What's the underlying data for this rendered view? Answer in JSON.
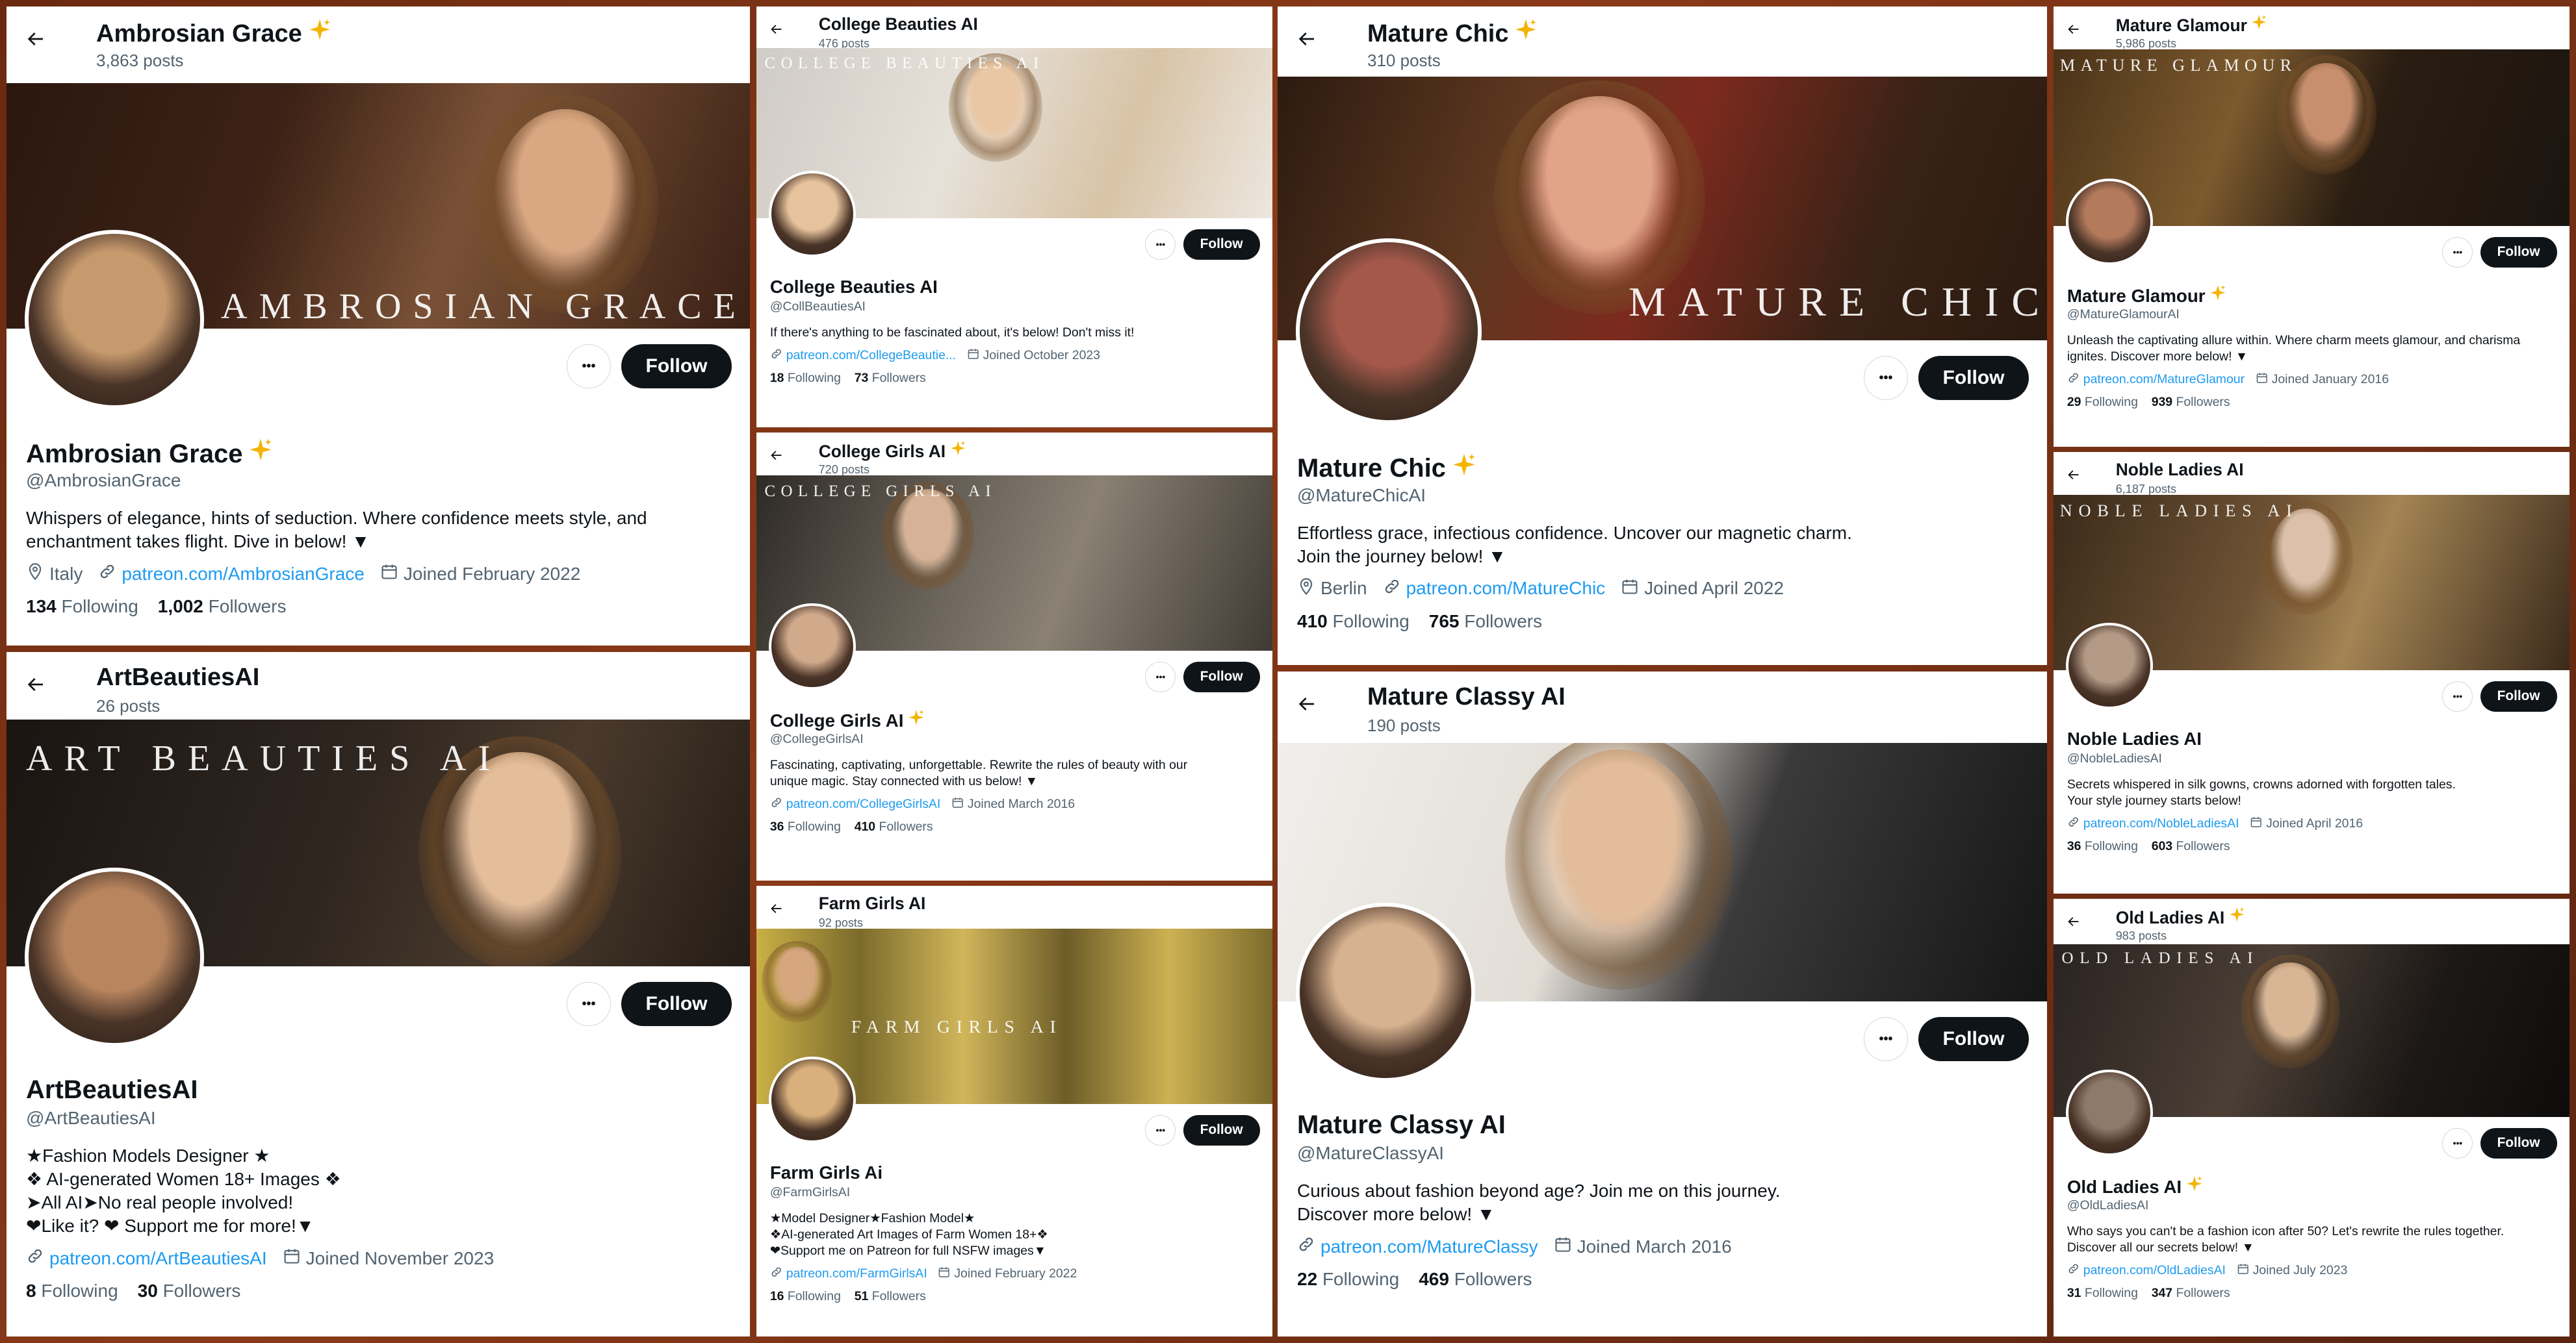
{
  "profiles": [
    {
      "header_name": "Ambrosian Grace",
      "posts": "3,863 posts",
      "banner_title": "AMBROSIAN GRACE AI",
      "name": "Ambrosian Grace",
      "handle": "@AmbrosianGrace",
      "bio": [
        "Whispers of elegance, hints of seduction. Where confidence meets style, and",
        "enchantment takes flight. Dive in below! ▼"
      ],
      "location": "Italy",
      "link": "patreon.com/AmbrosianGrace",
      "joined": "Joined February 2022",
      "following": "134",
      "followers": "1,002",
      "following_label": "Following",
      "followers_label": "Followers",
      "follow": "Follow",
      "more": "•••",
      "verified": true
    },
    {
      "header_name": "ArtBeautiesAI",
      "posts": "26 posts",
      "banner_title": "ART BEAUTIES AI",
      "name": "ArtBeautiesAI",
      "handle": "@ArtBeautiesAI",
      "bio": [
        "★Fashion Models Designer ★",
        "❖ AI-generated Women 18+ Images ❖",
        "➤All AI➤No real people involved!",
        "❤Like it? ❤ Support me for more!▼"
      ],
      "location": "",
      "link": "patreon.com/ArtBeautiesAI",
      "joined": "Joined November 2023",
      "following": "8",
      "followers": "30",
      "following_label": "Following",
      "followers_label": "Followers",
      "follow": "Follow",
      "more": "•••",
      "verified": false
    },
    {
      "header_name": "College Beauties AI",
      "posts": "476 posts",
      "banner_title": "COLLEGE BEAUTIES AI",
      "name": "College Beauties AI",
      "handle": "@CollBeautiesAI",
      "bio": [
        "If there's anything to be fascinated about, it's below! Don't miss it!"
      ],
      "location": "",
      "link": "patreon.com/CollegeBeautie...",
      "joined": "Joined October 2023",
      "following": "18",
      "followers": "73",
      "following_label": "Following",
      "followers_label": "Followers",
      "follow": "Follow",
      "more": "•••",
      "verified": false
    },
    {
      "header_name": "College Girls AI",
      "posts": "720 posts",
      "banner_title": "COLLEGE GIRLS AI",
      "name": "College Girls AI",
      "handle": "@CollegeGirlsAI",
      "bio": [
        "Fascinating, captivating, unforgettable. Rewrite the rules of beauty with our",
        "unique magic. Stay connected with us below! ▼"
      ],
      "location": "",
      "link": "patreon.com/CollegeGirlsAI",
      "joined": "Joined March 2016",
      "following": "36",
      "followers": "410",
      "following_label": "Following",
      "followers_label": "Followers",
      "follow": "Follow",
      "more": "•••",
      "verified": true
    },
    {
      "header_name": "Farm Girls AI",
      "posts": "92 posts",
      "banner_title": "FARM GIRLS AI",
      "name": "Farm Girls Ai",
      "handle": "@FarmGirlsAI",
      "bio": [
        "★Model Designer★Fashion Model★",
        "❖AI-generated Art Images of Farm Women 18+❖",
        "❤Support me on Patreon for full NSFW images▼"
      ],
      "location": "",
      "link": "patreon.com/FarmGirlsAI",
      "joined": "Joined February 2022",
      "following": "16",
      "followers": "51",
      "following_label": "Following",
      "followers_label": "Followers",
      "follow": "Follow",
      "more": "•••",
      "verified": false
    },
    {
      "header_name": "Mature Chic",
      "posts": "310 posts",
      "banner_title": "MATURE CHIC",
      "name": "Mature Chic",
      "handle": "@MatureChicAI",
      "bio": [
        "Effortless grace, infectious confidence. Uncover our magnetic charm.",
        "Join the journey below! ▼"
      ],
      "location": "Berlin",
      "link": "patreon.com/MatureChic",
      "joined": "Joined April 2022",
      "following": "410",
      "followers": "765",
      "following_label": "Following",
      "followers_label": "Followers",
      "follow": "Follow",
      "more": "•••",
      "verified": true
    },
    {
      "header_name": "Mature Classy AI",
      "posts": "190 posts",
      "banner_title": "",
      "name": "Mature Classy AI",
      "handle": "@MatureClassyAI",
      "bio": [
        "Curious about fashion beyond age? Join me on this journey.",
        "Discover more below! ▼"
      ],
      "location": "",
      "link": "patreon.com/MatureClassy",
      "joined": "Joined March 2016",
      "following": "22",
      "followers": "469",
      "following_label": "Following",
      "followers_label": "Followers",
      "follow": "Follow",
      "more": "•••",
      "verified": false
    },
    {
      "header_name": "Mature Glamour",
      "posts": "5,986 posts",
      "banner_title": "MATURE GLAMOUR",
      "name": "Mature Glamour",
      "handle": "@MatureGlamourAI",
      "bio": [
        "Unleash the captivating allure within. Where charm meets glamour, and charisma",
        "ignites.  Discover more below! ▼"
      ],
      "location": "",
      "link": "patreon.com/MatureGlamour",
      "joined": "Joined January 2016",
      "following": "29",
      "followers": "939",
      "following_label": "Following",
      "followers_label": "Followers",
      "follow": "Follow",
      "more": "•••",
      "verified": true
    },
    {
      "header_name": "Noble Ladies AI",
      "posts": "6,187 posts",
      "banner_title": "NOBLE LADIES AI",
      "name": "Noble Ladies AI",
      "handle": "@NobleLadiesAI",
      "bio": [
        "Secrets whispered in silk gowns, crowns adorned with forgotten tales.",
        "Your style journey starts below!"
      ],
      "location": "",
      "link": "patreon.com/NobleLadiesAI",
      "joined": "Joined April 2016",
      "following": "36",
      "followers": "603",
      "following_label": "Following",
      "followers_label": "Followers",
      "follow": "Follow",
      "more": "•••",
      "verified": false
    },
    {
      "header_name": "Old Ladies AI",
      "posts": "983 posts",
      "banner_title": "OLD LADIES AI",
      "name": "Old Ladies AI",
      "handle": "@OldLadiesAI",
      "bio": [
        "Who says you can't be a fashion icon after 50? Let's rewrite the rules together.",
        "Discover all our secrets below! ▼"
      ],
      "location": "",
      "link": "patreon.com/OldLadiesAI",
      "joined": "Joined July 2023",
      "following": "31",
      "followers": "347",
      "following_label": "Following",
      "followers_label": "Followers",
      "follow": "Follow",
      "more": "•••",
      "verified": true
    }
  ],
  "colors": {
    "text_primary": "#0f1419",
    "text_secondary": "#536471",
    "link": "#1d9bf0",
    "follow_bg": "#0f1419",
    "sparkle": "#f4b400",
    "accent_red": "#e0245e"
  },
  "icons": {
    "back": "back-arrow-icon",
    "verified": "sparkle-icon",
    "location": "location-pin-icon",
    "link": "link-icon",
    "calendar": "calendar-icon"
  }
}
